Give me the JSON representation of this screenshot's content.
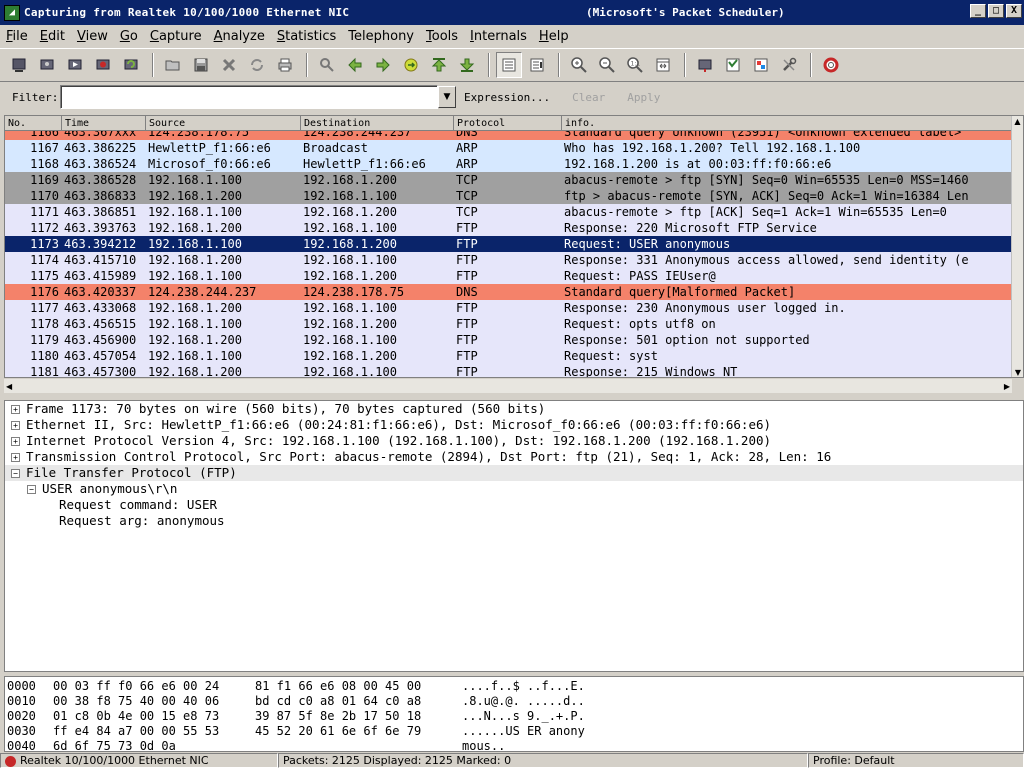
{
  "window": {
    "title": "Capturing from Realtek 10/100/1000 Ethernet NIC",
    "subtitle": "(Microsoft's Packet Scheduler)",
    "minimize": "_",
    "maximize": "□",
    "close": "X"
  },
  "menu": {
    "items": [
      {
        "u": "F",
        "rest": "ile"
      },
      {
        "u": "E",
        "rest": "dit"
      },
      {
        "u": "V",
        "rest": "iew"
      },
      {
        "u": "G",
        "rest": "o"
      },
      {
        "u": "C",
        "rest": "apture"
      },
      {
        "u": "A",
        "rest": "nalyze"
      },
      {
        "u": "S",
        "rest": "tatistics"
      },
      {
        "u": "",
        "rest": "Telephony"
      },
      {
        "u": "T",
        "rest": "ools"
      },
      {
        "u": "I",
        "rest": "nternals"
      },
      {
        "u": "H",
        "rest": "elp"
      }
    ]
  },
  "filter": {
    "label": "Filter:",
    "value": "",
    "expression": "Expression...",
    "clear": "Clear",
    "apply": "Apply"
  },
  "packet_list": {
    "columns": [
      "No.",
      "Time",
      "Source",
      "Destination",
      "Protocol",
      "info."
    ],
    "rows": [
      {
        "no": "1166",
        "time": "463.367xxx",
        "src": "124.238.178.75",
        "dst": "124.238.244.237",
        "proto": "DNS",
        "info": "Standard query Unknown (23951) <Unknown extended label>",
        "bg": "#f4826a",
        "fg": "#000"
      },
      {
        "no": "1167",
        "time": "463.386225",
        "src": "HewlettP_f1:66:e6",
        "dst": "Broadcast",
        "proto": "ARP",
        "info": "Who has 192.168.1.200?  Tell 192.168.1.100",
        "bg": "#d6e8ff",
        "fg": "#000"
      },
      {
        "no": "1168",
        "time": "463.386524",
        "src": "Microsof_f0:66:e6",
        "dst": "HewlettP_f1:66:e6",
        "proto": "ARP",
        "info": "192.168.1.200 is at 00:03:ff:f0:66:e6",
        "bg": "#d6e8ff",
        "fg": "#000"
      },
      {
        "no": "1169",
        "time": "463.386528",
        "src": "192.168.1.100",
        "dst": "192.168.1.200",
        "proto": "TCP",
        "info": "abacus-remote > ftp [SYN] Seq=0 Win=65535 Len=0 MSS=1460",
        "bg": "#a0a0a0",
        "fg": "#000"
      },
      {
        "no": "1170",
        "time": "463.386833",
        "src": "192.168.1.200",
        "dst": "192.168.1.100",
        "proto": "TCP",
        "info": "ftp > abacus-remote [SYN, ACK] Seq=0 Ack=1 Win=16384 Len",
        "bg": "#a0a0a0",
        "fg": "#000"
      },
      {
        "no": "1171",
        "time": "463.386851",
        "src": "192.168.1.100",
        "dst": "192.168.1.200",
        "proto": "TCP",
        "info": "abacus-remote > ftp [ACK] Seq=1 Ack=1 Win=65535 Len=0",
        "bg": "#e6e6fa",
        "fg": "#000"
      },
      {
        "no": "1172",
        "time": "463.393763",
        "src": "192.168.1.200",
        "dst": "192.168.1.100",
        "proto": "FTP",
        "info": "Response: 220 Microsoft FTP Service",
        "bg": "#e6e6fa",
        "fg": "#000"
      },
      {
        "no": "1173",
        "time": "463.394212",
        "src": "192.168.1.100",
        "dst": "192.168.1.200",
        "proto": "FTP",
        "info": "Request: USER anonymous",
        "bg": "#0a246a",
        "fg": "#fff"
      },
      {
        "no": "1174",
        "time": "463.415710",
        "src": "192.168.1.200",
        "dst": "192.168.1.100",
        "proto": "FTP",
        "info": "Response: 331 Anonymous access allowed, send identity (e",
        "bg": "#e6e6fa",
        "fg": "#000"
      },
      {
        "no": "1175",
        "time": "463.415989",
        "src": "192.168.1.100",
        "dst": "192.168.1.200",
        "proto": "FTP",
        "info": "Request: PASS IEUser@",
        "bg": "#e6e6fa",
        "fg": "#000"
      },
      {
        "no": "1176",
        "time": "463.420337",
        "src": "124.238.244.237",
        "dst": "124.238.178.75",
        "proto": "DNS",
        "info": "Standard query[Malformed Packet]",
        "bg": "#f4826a",
        "fg": "#000"
      },
      {
        "no": "1177",
        "time": "463.433068",
        "src": "192.168.1.200",
        "dst": "192.168.1.100",
        "proto": "FTP",
        "info": "Response: 230 Anonymous user logged in.",
        "bg": "#e6e6fa",
        "fg": "#000"
      },
      {
        "no": "1178",
        "time": "463.456515",
        "src": "192.168.1.100",
        "dst": "192.168.1.200",
        "proto": "FTP",
        "info": "Request: opts utf8 on",
        "bg": "#e6e6fa",
        "fg": "#000"
      },
      {
        "no": "1179",
        "time": "463.456900",
        "src": "192.168.1.200",
        "dst": "192.168.1.100",
        "proto": "FTP",
        "info": "Response: 501 option not supported",
        "bg": "#e6e6fa",
        "fg": "#000"
      },
      {
        "no": "1180",
        "time": "463.457054",
        "src": "192.168.1.100",
        "dst": "192.168.1.200",
        "proto": "FTP",
        "info": "Request: syst",
        "bg": "#e6e6fa",
        "fg": "#000"
      },
      {
        "no": "1181",
        "time": "463.457300",
        "src": "192.168.1.200",
        "dst": "192.168.1.100",
        "proto": "FTP",
        "info": "Response: 215 Windows_NT",
        "bg": "#e6e6fa",
        "fg": "#000"
      }
    ]
  },
  "details": {
    "rows": [
      {
        "indent": 0,
        "toggle": "+",
        "text": "Frame 1173: 70 bytes on wire (560 bits), 70 bytes captured (560 bits)",
        "selected": false
      },
      {
        "indent": 0,
        "toggle": "+",
        "text": "Ethernet II, Src: HewlettP_f1:66:e6 (00:24:81:f1:66:e6), Dst: Microsof_f0:66:e6 (00:03:ff:f0:66:e6)",
        "selected": false
      },
      {
        "indent": 0,
        "toggle": "+",
        "text": "Internet Protocol Version 4, Src: 192.168.1.100 (192.168.1.100), Dst: 192.168.1.200 (192.168.1.200)",
        "selected": false
      },
      {
        "indent": 0,
        "toggle": "+",
        "text": "Transmission Control Protocol, Src Port: abacus-remote (2894), Dst Port: ftp (21), Seq: 1, Ack: 28, Len: 16",
        "selected": false
      },
      {
        "indent": 0,
        "toggle": "−",
        "text": "File Transfer Protocol (FTP)",
        "selected": true
      },
      {
        "indent": 1,
        "toggle": "−",
        "text": "USER anonymous\\r\\n",
        "selected": false
      },
      {
        "indent": 2,
        "toggle": "",
        "text": "Request command: USER",
        "selected": false
      },
      {
        "indent": 2,
        "toggle": "",
        "text": "Request arg: anonymous",
        "selected": false
      }
    ]
  },
  "hex": {
    "rows": [
      {
        "off": "0000",
        "b1": "00 03 ff f0 66 e6 00 24",
        "b2": "81 f1 66 e6 08 00 45 00",
        "asc": "....f..$ ..f...E."
      },
      {
        "off": "0010",
        "b1": "00 38 f8 75 40 00 40 06",
        "b2": "bd cd c0 a8 01 64 c0 a8",
        "asc": ".8.u@.@. .....d.."
      },
      {
        "off": "0020",
        "b1": "01 c8 0b 4e 00 15 e8 73",
        "b2": "39 87 5f 8e 2b 17 50 18",
        "asc": "...N...s 9._.+.P."
      },
      {
        "off": "0030",
        "b1": "ff e4 84 a7 00 00 55 53",
        "b2": "45 52 20 61 6e 6f 6e 79",
        "asc": "......US ER anony"
      },
      {
        "off": "0040",
        "b1": "6d 6f 75 73 0d 0a",
        "b2": "",
        "asc": "mous.."
      }
    ]
  },
  "status": {
    "interface": "Realtek 10/100/1000 Ethernet NIC",
    "packets": "Packets: 2125 Displayed: 2125 Marked: 0",
    "profile": "Profile: Default"
  }
}
